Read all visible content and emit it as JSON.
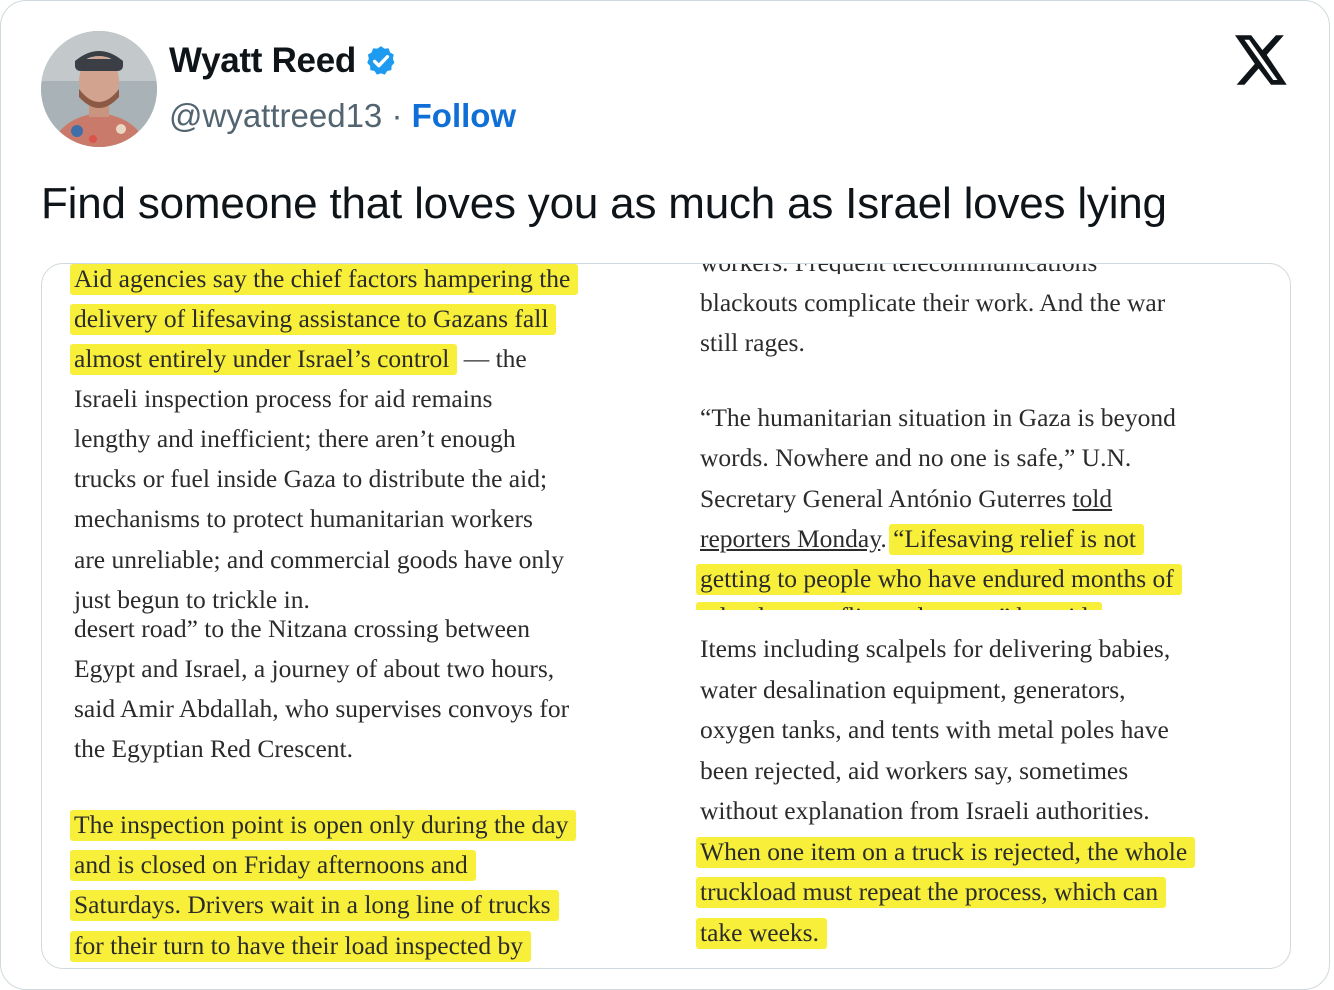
{
  "tweet": {
    "author_name": "Wyatt Reed",
    "handle": "@wyattreed13",
    "separator": "·",
    "follow_label": "Follow",
    "text": "Find someone that loves you as much as Israel loves lying"
  },
  "icons": {
    "verified": "verified-badge-icon",
    "x_logo": "x-logo-icon"
  },
  "colors": {
    "verified_blue": "#1d9bf0",
    "follow_blue": "#0f6fd6",
    "highlight": "#f7ef3a",
    "handle_gray": "#536471"
  },
  "article": {
    "left_col": {
      "p1_hl": [
        "Aid agencies say the chief factors hampering the",
        "delivery of lifesaving assistance to Gazans fall",
        "almost entirely under Israel’s control"
      ],
      "p1_tail": "— the",
      "p1_rest": [
        "Israeli inspection process for aid remains",
        "lengthy and inefficient; there aren’t enough",
        "trucks or fuel inside Gaza to distribute the aid;",
        "mechanisms to protect humanitarian workers",
        "are unreliable; and commercial goods have only",
        "just begun to trickle in."
      ],
      "p2": [
        "desert road” to the Nitzana crossing between",
        "Egypt and Israel, a journey of about two hours,",
        "said Amir Abdallah, who supervises convoys for",
        "the Egyptian Red Crescent."
      ],
      "p3_hl": [
        "The inspection point is open only during the day",
        "and is closed on Friday afternoons and",
        "Saturdays. Drivers wait in a long line of trucks",
        "for their turn to have their load inspected by"
      ]
    },
    "right_col": {
      "p1_cut": "workers. Frequent telecommunications",
      "p1": [
        "blackouts complicate their work. And the war",
        "still rages."
      ],
      "p2_lines": [
        "“The humanitarian situation in Gaza is beyond",
        "words. Nowhere and no one is safe,” U.N."
      ],
      "p2_sg_a": "Secretary General António Guterres ",
      "p2_link_a": "told",
      "p2_link_b": "reporters Monday",
      "p2_dot": ".",
      "p2_hl_a": "“Lifesaving relief is not",
      "p2_hl_b": "getting to people who have endured months of",
      "p2_hl_c": "relentless conflict and unrest,” he said.",
      "p3": [
        "Items including scalpels for delivering babies,",
        "water desalination equipment, generators,",
        "oxygen tanks, and tents with metal poles have",
        "been rejected, aid workers say, sometimes",
        "without explanation from Israeli authorities."
      ],
      "p3_hl": [
        "When one item on a truck is rejected, the whole",
        "truckload must repeat the process, which can",
        "take weeks."
      ]
    }
  }
}
